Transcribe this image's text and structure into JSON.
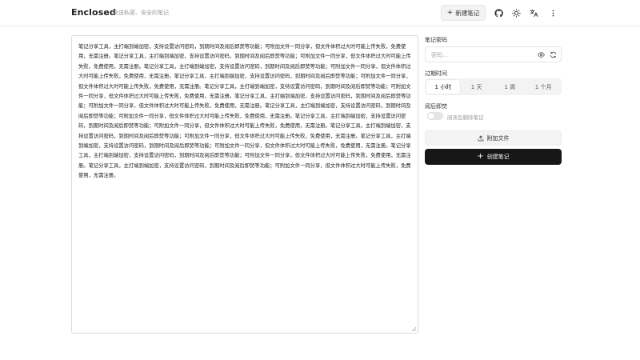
{
  "header": {
    "brand": "Enclosed",
    "tagline": "发送私密、安全的笔记",
    "new_note_label": "新建笔记",
    "icons": [
      "plus-icon",
      "github-icon",
      "sun-icon",
      "translate-icon",
      "more-vertical-icon"
    ]
  },
  "editor": {
    "content": "笔记分享工具，主打端到端加密，支持设置访问密码，到期时间及阅后即焚等功能；可附加文件一同分享，但文件体积过大时可能上传失败，免费使用，无需注册。笔记分享工具，主打端到端加密，支持设置访问密码，到期时间及阅后即焚等功能；可附加文件一同分享，但文件体积过大时可能上传失败，免费使用，无需注册。笔记分享工具，主打端到端加密，支持设置访问密码，到期时间及阅后即焚等功能；可附加文件一同分享，但文件体积过大时可能上传失败，免费使用，无需注册。笔记分享工具，主打端到端加密，支持设置访问密码，到期时间及阅后即焚等功能；可附加文件一同分享，但文件体积过大时可能上传失败，免费使用，无需注册。笔记分享工具，主打端到端加密，支持设置访问密码，到期时间及阅后即焚等功能；可附加文件一同分享，但文件体积过大时可能上传失败，免费使用，无需注册。笔记分享工具，主打端到端加密，支持设置访问密码，到期时间及阅后即焚等功能；可附加文件一同分享，但文件体积过大时可能上传失败，免费使用，无需注册。笔记分享工具，主打端到端加密，支持设置访问密码，到期时间及阅后即焚等功能；可附加文件一同分享，但文件体积过大时可能上传失败，免费使用，无需注册。笔记分享工具，主打端到端加密，支持设置访问密码，到期时间及阅后即焚等功能；可附加文件一同分享，但文件体积过大时可能上传失败，免费使用，无需注册。笔记分享工具，主打端到端加密，支持设置访问密码，到期时间及阅后即焚等功能；可附加文件一同分享，但文件体积过大时可能上传失败，免费使用，无需注册。笔记分享工具，主打端到端加密，支持设置访问密码，到期时间及阅后即焚等功能；可附加文件一同分享，但文件体积过大时可能上传失败，免费使用，无需注册。笔记分享工具，主打端到端加密，支持设置访问密码，到期时间及阅后即焚等功能；可附加文件一同分享，但文件体积过大时可能上传失败，免费使用，无需注册。笔记分享工具，主打端到端加密，支持设置访问密码，到期时间及阅后即焚等功能；可附加文件一同分享，但文件体积过大时可能上传失败，免费使用，无需注册。"
  },
  "side": {
    "password_label": "笔记密码",
    "password_placeholder": "密码...",
    "expiration_label": "过期时间",
    "expiration_options": [
      "1 小时",
      "1 天",
      "1 周",
      "1 个月"
    ],
    "expiration_selected": "1 小时",
    "burn_label": "阅后即焚",
    "burn_toggle_text": "阅读后删除笔记",
    "burn_enabled": false,
    "attach_label": "附加文件",
    "create_label": "创建笔记"
  },
  "colors": {
    "primary_button": "#171717",
    "muted_text": "#9a9a9a",
    "border": "#dcdcdc"
  }
}
